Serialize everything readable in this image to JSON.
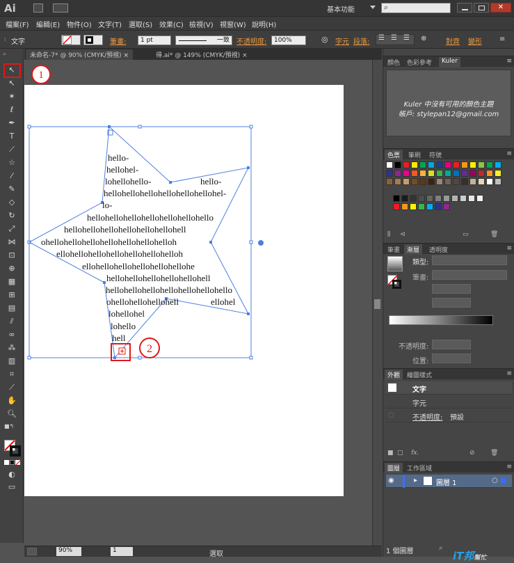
{
  "app": {
    "logo": "Ai",
    "workspace": "基本功能",
    "search_icon": "⌕"
  },
  "menu": [
    "檔案(F)",
    "編輯(E)",
    "物件(O)",
    "文字(T)",
    "選取(S)",
    "效果(C)",
    "檢視(V)",
    "視窗(W)",
    "說明(H)"
  ],
  "control": {
    "type_label": "文字",
    "stroke_label": "筆畫:",
    "stroke_value": "1 pt",
    "stroke_style": "一致",
    "opacity_label": "不透明度:",
    "opacity_value": "100%",
    "char_label": "字元",
    "para_label": "段落:",
    "align_label": "對齊",
    "transform_label": "變形"
  },
  "tabs": [
    "未命名-7* @ 90% (CMYK/預視)",
    "得.ai* @ 149% (CMYK/預視)"
  ],
  "markers": [
    "1",
    "2"
  ],
  "text_lines": [
    "hello-",
    "hellohel-",
    "lohellohello-",
    "hello-",
    "hellohellohellohellohellohellohel-",
    "lo-",
    "hellohellohellohellohellohellohello",
    "hellohellohellohellohellohellohell",
    "ohellohellohellohellohellohellohelloh",
    "ellohellohellohellohellohellohelloh",
    "ellohellohellohellohellohellohe",
    "hellohellohellohellohellohell",
    "hellohellohellohellohellohellohello",
    "ohellohellohellohell",
    "ohellohellohelloh",
    "ellohel",
    "lohellohel",
    "lohello",
    "hell"
  ],
  "status": {
    "zoom": "90%",
    "page": "1",
    "mode": "選取"
  },
  "kuler": {
    "tabs": [
      "顏色",
      "色彩參考",
      "Kuler"
    ],
    "message": "Kuler 中沒有可用的顏色主題",
    "account": "帳戶: stylepan12@gmail.com"
  },
  "swatches": {
    "tabs": [
      "色票",
      "筆刷",
      "符號"
    ],
    "row1": [
      "#ffffff",
      "#000000",
      "#e31e24",
      "#fde800",
      "#00a650",
      "#00a9e0",
      "#1b3d93",
      "#e5007e",
      "#ed1c24",
      "#f7941d",
      "#fff200",
      "#8dc63f",
      "#00a651",
      "#00aeef"
    ],
    "row2": [
      "#2e3192",
      "#92278f",
      "#ec008c",
      "#f15a24",
      "#fbb040",
      "#d9e021",
      "#39b54a",
      "#00a99d",
      "#0071bc",
      "#662d91",
      "#9e005d",
      "#c1272d",
      "#f7931e",
      "#fcee21"
    ],
    "row3": [
      "#8c6239",
      "#a67c52",
      "#c69c6d",
      "#754c24",
      "#603813",
      "#42210b",
      "#998675",
      "#736357",
      "#534741",
      "#362f2d",
      "#c7b299",
      "#e6d7b8",
      "#ffffff",
      "#bfbfbf"
    ],
    "row4": [
      "#000000",
      "#1a1a1a",
      "#333333",
      "#4d4d4d",
      "#666666",
      "#808080",
      "#999999",
      "#b3b3b3",
      "#cccccc",
      "#e6e6e6",
      "#f2f2f2"
    ],
    "row5": [
      "#ed1c24",
      "#f7941d",
      "#fff200",
      "#39b54a",
      "#00aeef",
      "#2e3192",
      "#92278f"
    ]
  },
  "gradient": {
    "tabs": [
      "筆畫",
      "漸層",
      "透明度"
    ],
    "type_label": "類型:",
    "stroke_label": "筆畫:",
    "opacity_label": "不透明度:",
    "position_label": "位置:"
  },
  "appearance": {
    "tabs": [
      "外觀",
      "繪圖樣式"
    ],
    "item_type": "文字",
    "char": "字元",
    "opacity_label": "不透明度:",
    "opacity_value": "預設"
  },
  "layers": {
    "tabs": [
      "圖層",
      "工作區域"
    ],
    "layer_name": "圖層 1",
    "count": "1 個圖層"
  },
  "watermark": {
    "brand": "iT邦",
    "sub": "幫忙"
  }
}
